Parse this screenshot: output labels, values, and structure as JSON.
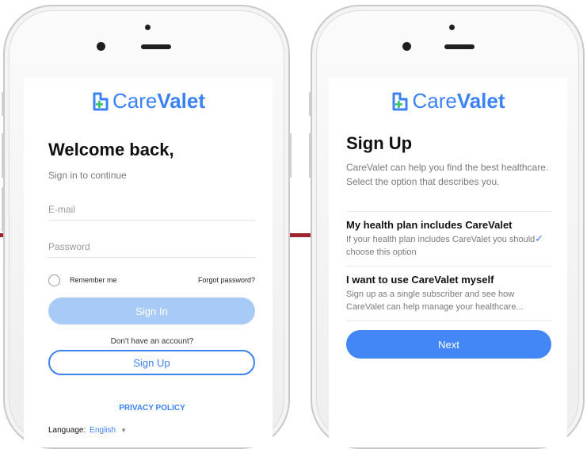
{
  "brand": {
    "name_light": "Care",
    "name_bold": "Valet",
    "color": "#3b82f6",
    "icon": "carevalet-logo-icon"
  },
  "login_screen": {
    "heading": "Welcome back,",
    "subtitle": "Sign in to continue",
    "email_placeholder": "E-mail",
    "password_placeholder": "Password",
    "remember_label": "Remember me",
    "forgot_label": "Forgot password?",
    "signin_label": "Sign In",
    "no_account_text": "Don't have an account?",
    "signup_label": "Sign Up",
    "privacy_label": "PRIVACY POLICY",
    "language_label": "Language:",
    "language_value": "English"
  },
  "signup_screen": {
    "heading": "Sign Up",
    "description": "CareValet can help you find the best healthcare. Select the option that describes you.",
    "options": [
      {
        "title": "My health plan includes CareValet",
        "description": "If your health plan includes CareValet you should choose this option",
        "selected": true
      },
      {
        "title": "I want to use CareValet myself",
        "description": "Sign up as a single subscriber and see how CareValet can help manage your healthcare...",
        "selected": false
      }
    ],
    "next_label": "Next"
  },
  "colors": {
    "accent": "#3b82f6",
    "disabled_button": "#a7caf6",
    "divider": "#9e2430"
  }
}
